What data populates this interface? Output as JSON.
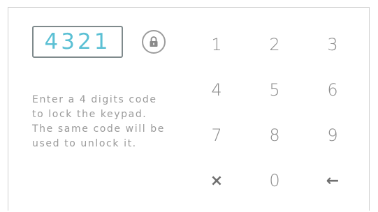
{
  "code_display": {
    "value": "4321"
  },
  "lock_button": {
    "icon": "lock-icon"
  },
  "instructions": {
    "text": "Enter a 4 digits code to lock the keypad. The same code will be used to unlock it."
  },
  "keypad": {
    "keys": [
      "1",
      "2",
      "3",
      "4",
      "5",
      "6",
      "7",
      "8",
      "9",
      "×",
      "0",
      "←"
    ]
  },
  "colors": {
    "code_text": "#5bc0d4",
    "key_text": "#8a8a8a",
    "instruction_text": "#9a9a9a",
    "border": "#cfcfcf"
  }
}
